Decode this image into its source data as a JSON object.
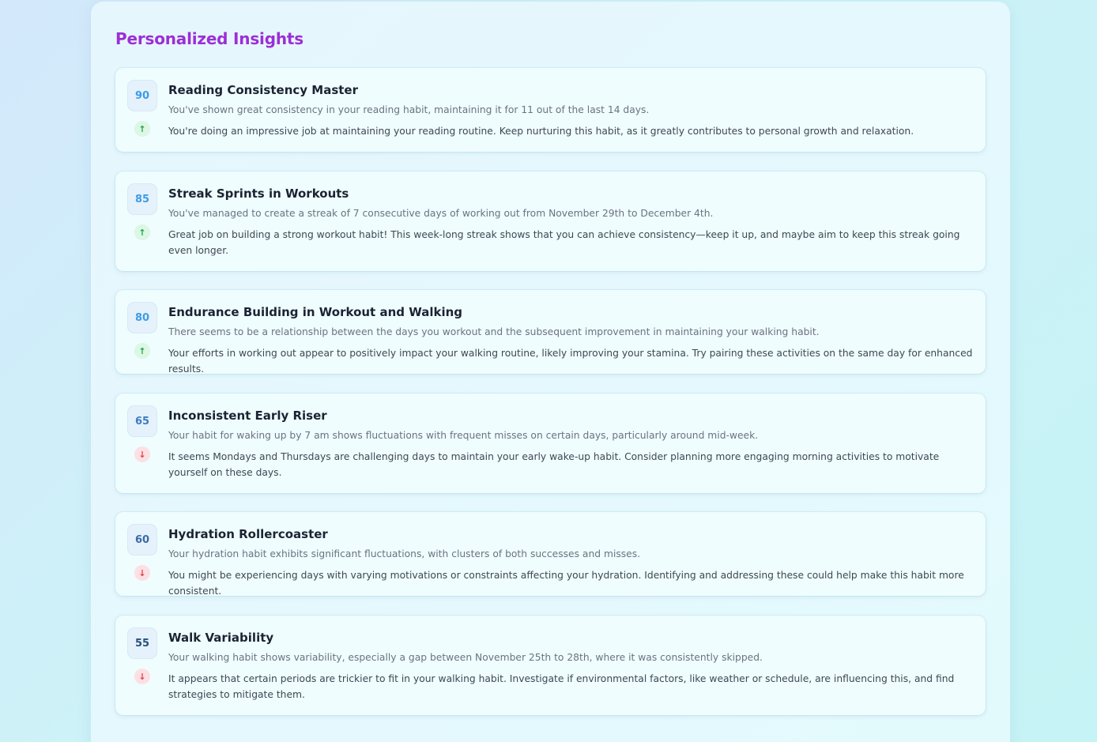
{
  "panel": {
    "title": "Personalized Insights"
  },
  "colors": {
    "title": "#9b2fd6",
    "trend_up": "#23a356",
    "trend_down": "#e0404f",
    "badge_high": "#3f9be6",
    "badge_mid": "#3b7bc2",
    "badge_low": "#284f7d"
  },
  "insights": [
    {
      "score": "90",
      "trend": "↑",
      "trend_direction": "up",
      "title": "Reading Consistency Master",
      "observation": "You've shown great consistency in your reading habit, maintaining it for 11 out of the last 14 days.",
      "recommendation": "You're doing an impressive job at maintaining your reading routine. Keep nurturing this habit, as it greatly contributes to personal growth and relaxation."
    },
    {
      "score": "85",
      "trend": "↑",
      "trend_direction": "up",
      "title": "Streak Sprints in Workouts",
      "observation": "You've managed to create a streak of 7 consecutive days of working out from November 29th to December 4th.",
      "recommendation": "Great job on building a strong workout habit! This week-long streak shows that you can achieve consistency—keep it up, and maybe aim to keep this streak going even longer."
    },
    {
      "score": "80",
      "trend": "↑",
      "trend_direction": "up",
      "title": "Endurance Building in Workout and Walking",
      "observation": "There seems to be a relationship between the days you workout and the subsequent improvement in maintaining your walking habit.",
      "recommendation": "Your efforts in working out appear to positively impact your walking routine, likely improving your stamina. Try pairing these activities on the same day for enhanced results."
    },
    {
      "score": "65",
      "trend": "↓",
      "trend_direction": "down",
      "title": "Inconsistent Early Riser",
      "observation": "Your habit for waking up by 7 am shows fluctuations with frequent misses on certain days, particularly around mid-week.",
      "recommendation": "It seems Mondays and Thursdays are challenging days to maintain your early wake-up habit. Consider planning more engaging morning activities to motivate yourself on these days."
    },
    {
      "score": "60",
      "trend": "↓",
      "trend_direction": "down",
      "title": "Hydration Rollercoaster",
      "observation": "Your hydration habit exhibits significant fluctuations, with clusters of both successes and misses.",
      "recommendation": "You might be experiencing days with varying motivations or constraints affecting your hydration. Identifying and addressing these could help make this habit more consistent."
    },
    {
      "score": "55",
      "trend": "↓",
      "trend_direction": "down",
      "title": "Walk Variability",
      "observation": "Your walking habit shows variability, especially a gap between November 25th to 28th, where it was consistently skipped.",
      "recommendation": "It appears that certain periods are trickier to fit in your walking habit. Investigate if environmental factors, like weather or schedule, are influencing this, and find strategies to mitigate them."
    }
  ]
}
